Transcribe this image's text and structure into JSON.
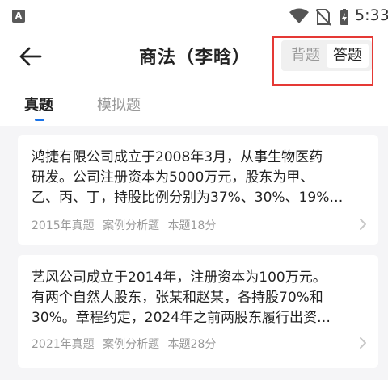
{
  "status_bar": {
    "notification_letter": "A",
    "time": "5:33",
    "icons": [
      "wifi-icon",
      "no-sim-icon",
      "battery-charging-icon"
    ]
  },
  "header": {
    "back_icon": "arrow-left-icon",
    "title": "商法（李晗）",
    "mode_options": [
      "背题",
      "答题"
    ],
    "selected_mode": "答题",
    "highlight_color": "#e53935"
  },
  "tabs": {
    "items": [
      "真题",
      "模拟题"
    ],
    "active": "真题",
    "accent_color": "#1a73e8"
  },
  "questions": [
    {
      "lines": [
        "鸿捷有限公司成立于2008年3月，从事生物医药",
        "研发。公司注册资本为5000万元，股东为甲、",
        "乙、丙、丁，持股比例分别为37%、30%、19%…"
      ],
      "year": "2015年真题",
      "type": "案例分析题",
      "score": "本题18分"
    },
    {
      "lines": [
        "艺风公司成立于2014年，注册资本为100万元。",
        "有两个自然人股东，张某和赵某，各持股70%和",
        "30%。章程约定，2024年之前两股东履行出资…"
      ],
      "year": "2021年真题",
      "type": "案例分析题",
      "score": "本题28分"
    }
  ]
}
